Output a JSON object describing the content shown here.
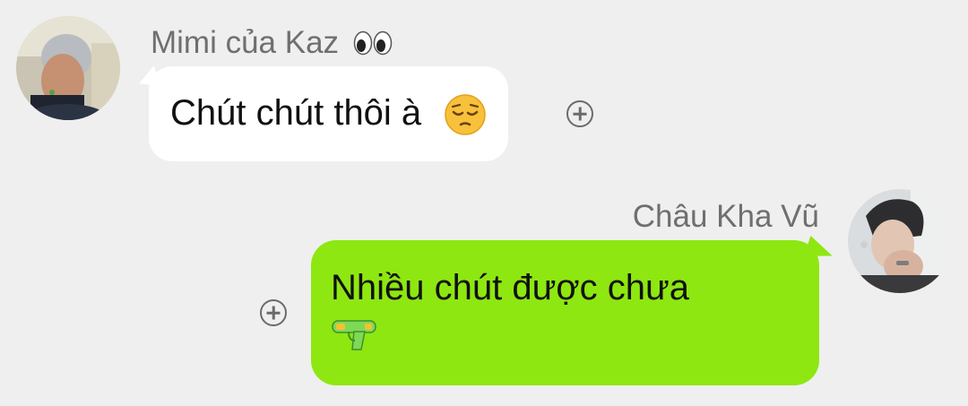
{
  "messages": [
    {
      "sender": "Mimi của Kaz",
      "sender_emoji": "eyes-emoji",
      "text": "Chút chút thôi à",
      "text_emoji": "pensive-face-emoji",
      "side": "left",
      "bubble_color": "#ffffff"
    },
    {
      "sender": "Châu Kha Vũ",
      "text": "Nhiều chút được chưa",
      "text_emoji": "water-pistol-emoji",
      "side": "right",
      "bubble_color": "#8ee711"
    }
  ],
  "colors": {
    "background": "#efefef",
    "sender_name": "#6f6f6f",
    "message_text": "#111111",
    "react_icon": "#6b6b6b"
  }
}
